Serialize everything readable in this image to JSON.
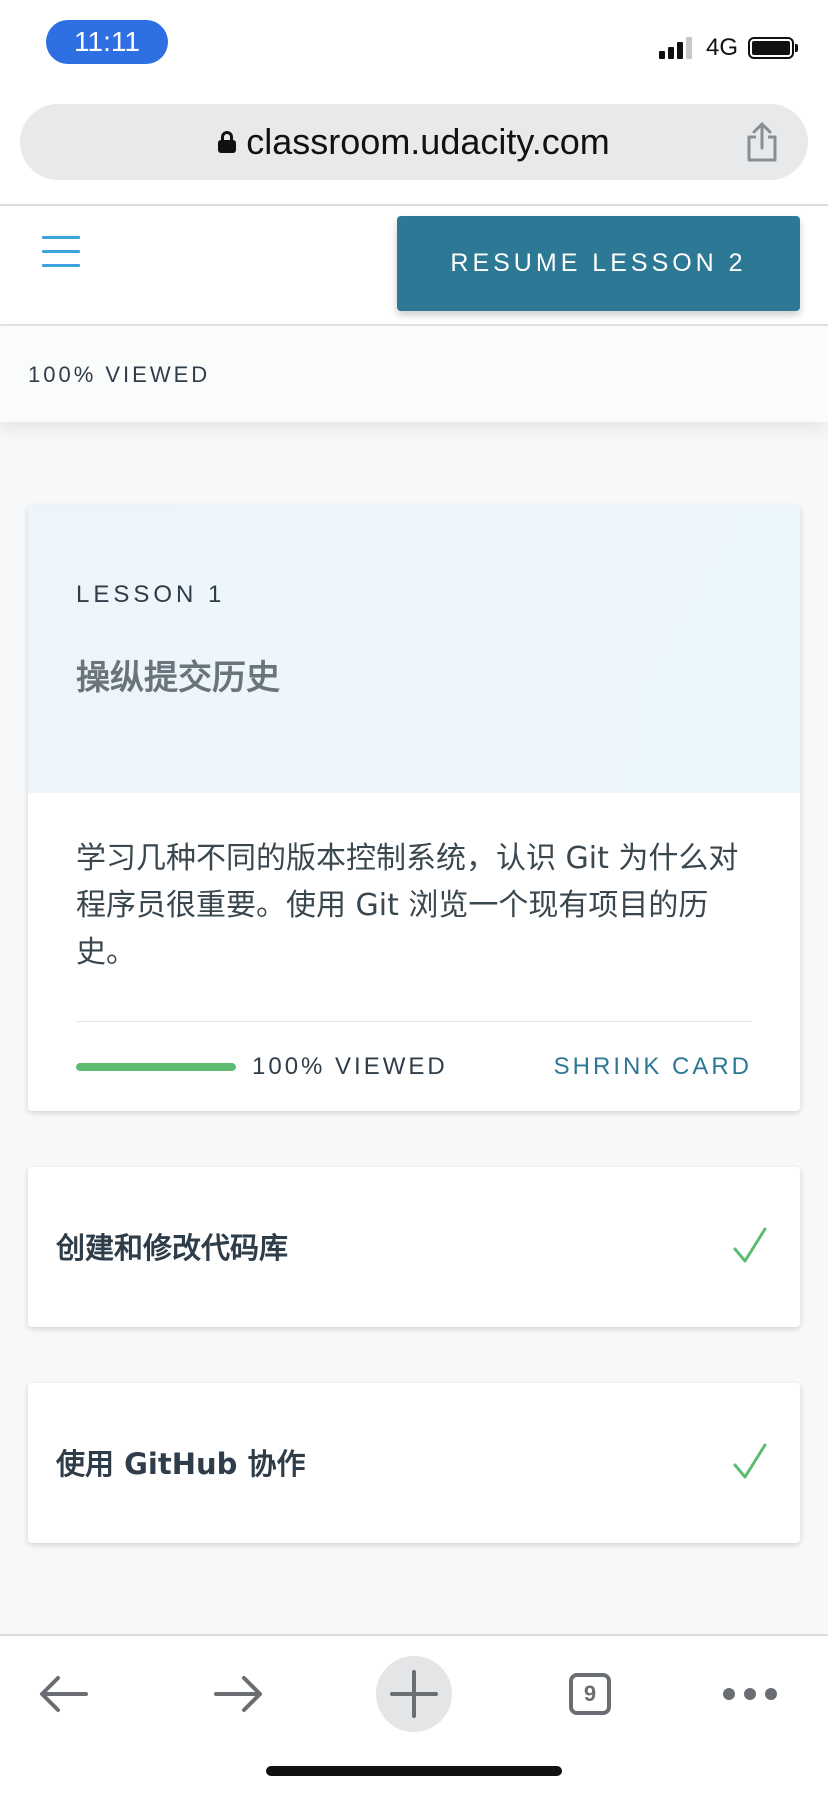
{
  "status_bar": {
    "time": "11:11",
    "network": "4G"
  },
  "browser": {
    "url": "classroom.udacity.com",
    "tab_count": "9"
  },
  "header": {
    "resume_button_label": "RESUME LESSON 2"
  },
  "progress_strip": {
    "label": "100% VIEWED"
  },
  "lesson_card": {
    "lesson_label": "LESSON 1",
    "title": "操纵提交历史",
    "description": "学习几种不同的版本控制系统，认识 Git 为什么对程序员很重要。使用 Git 浏览一个现有项目的历史。",
    "progress_fraction": 1.0,
    "progress_label": "100% VIEWED",
    "shrink_label": "SHRINK CARD"
  },
  "lessons": [
    {
      "title": "创建和修改代码库",
      "completed": true
    },
    {
      "title": "使用 GitHub 协作",
      "completed": true
    }
  ],
  "colors": {
    "accent": "#2d7895",
    "progress": "#5dbb71",
    "hamburger": "#3fa2dc",
    "time_pill": "#2f6fe4"
  },
  "icons": {
    "menu": "hamburger-icon",
    "lock": "lock-icon",
    "share": "share-icon",
    "check": "check-icon",
    "back": "back-arrow-icon",
    "forward": "forward-arrow-icon",
    "new_tab": "plus-icon",
    "more": "more-icon"
  }
}
